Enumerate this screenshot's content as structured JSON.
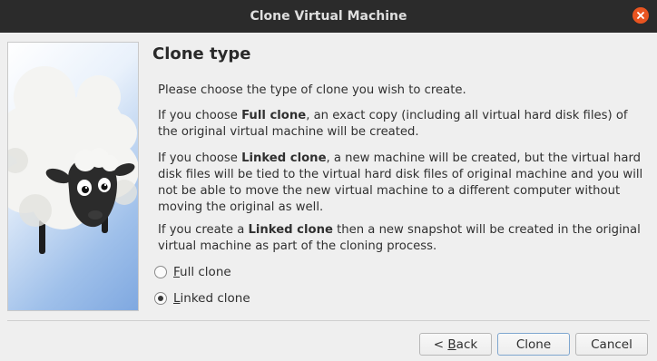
{
  "window": {
    "title": "Clone Virtual Machine"
  },
  "page": {
    "heading": "Clone type",
    "intro": "Please choose the type of clone you wish to create.",
    "full_prefix": "If you choose ",
    "full_bold": "Full clone",
    "full_suffix": ", an exact copy (including all virtual hard disk files) of the original virtual machine will be created.",
    "linked_prefix": "If you choose ",
    "linked_bold": "Linked clone",
    "linked_suffix": ", a new machine will be created, but the virtual hard disk files will be tied to the virtual hard disk files of original machine and you will not be able to move the new virtual machine to a different computer without moving the original as well.",
    "snapshot_prefix": "If you create a ",
    "snapshot_bold": "Linked clone",
    "snapshot_suffix": " then a new snapshot will be created in the original virtual machine as part of the cloning process."
  },
  "options": {
    "full_clone": {
      "mnemonic": "F",
      "rest": "ull clone",
      "selected": false
    },
    "linked_clone": {
      "mnemonic": "L",
      "rest": "inked clone",
      "selected": true
    }
  },
  "buttons": {
    "back_prefix": "< ",
    "back_mnemonic": "B",
    "back_rest": "ack",
    "clone": "Clone",
    "cancel": "Cancel"
  },
  "icons": {
    "close": "close-icon",
    "illustration": "sheep-illustration"
  },
  "colors": {
    "titlebar": "#2b2b2b",
    "close_button": "#e95420",
    "background": "#efefef"
  }
}
